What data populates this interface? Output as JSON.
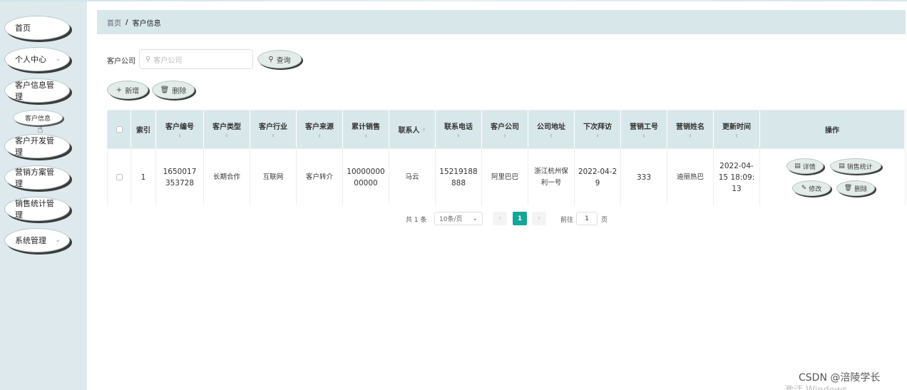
{
  "sidebar": {
    "items": [
      {
        "label": "首页",
        "chevron": false
      },
      {
        "label": "个人中心",
        "chevron": true
      },
      {
        "label": "客户信息管理",
        "chevron": false
      },
      {
        "label": "客户开发管理",
        "chevron": false
      },
      {
        "label": "营销方案管理",
        "chevron": false
      },
      {
        "label": "销售统计管理",
        "chevron": false
      },
      {
        "label": "系统管理",
        "chevron": true
      }
    ],
    "sub_item": "客户信息",
    "chevron_glyph": "⌄"
  },
  "breadcrumb": {
    "home": "首页",
    "separator": "/",
    "current": "客户信息"
  },
  "search": {
    "label": "客户公司",
    "placeholder": "客户公司",
    "search_button": "查询",
    "add_button": "新增",
    "delete_button": "删除"
  },
  "table": {
    "headers": [
      "索引",
      "客户编号",
      "客户类型",
      "客户行业",
      "客户来源",
      "累计销售",
      "联系人",
      "联系电话",
      "客户公司",
      "公司地址",
      "下次拜访",
      "营销工号",
      "营销姓名",
      "更新时间",
      "操作"
    ],
    "rows": [
      {
        "index": "1",
        "customer_no": "1650017353728",
        "customer_type": "长期合作",
        "industry": "互联网",
        "source": "客户转介",
        "total_sales": "1000000000000",
        "contact": "马云",
        "phone": "15219188888",
        "company": "阿里巴巴",
        "address": "浙江杭州保利一号",
        "next_visit": "2022-04-29",
        "sales_id": "333",
        "sales_name": "迪丽热巴",
        "updated": "2022-04-15 18:09:13"
      }
    ],
    "actions": {
      "detail": "详情",
      "stats": "销售统计",
      "edit": "修改",
      "delete": "删除"
    }
  },
  "pagination": {
    "total": "共 1 条",
    "page_size": "10条/页",
    "current_page": "1",
    "goto_label": "前往",
    "goto_value": "1",
    "unit": "页"
  },
  "watermark": {
    "text": "CSDN @涪陵学长",
    "faint": "激活 Windows"
  },
  "colors": {
    "sidebar_bg": "#dde9ec",
    "header_bg": "#d8e7ea",
    "accent": "#16a596"
  }
}
